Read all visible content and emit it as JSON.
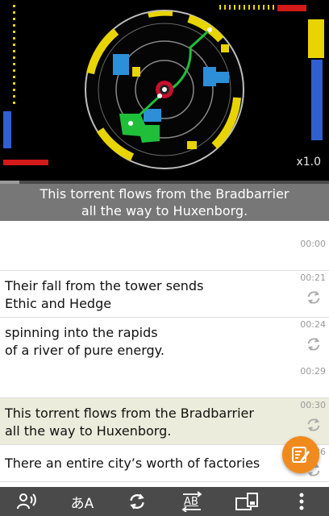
{
  "video": {
    "speed": "x1.0",
    "progress_fraction": 0.06
  },
  "caption": {
    "line1": "This torrent flows from the Bradbarrier",
    "line2": "all the way to Huxenborg."
  },
  "transcript": {
    "rows": [
      {
        "time": "00:00",
        "line1": "",
        "line2": ""
      },
      {
        "time": "00:21",
        "line1": "Their fall from the tower sends",
        "line2": "Ethic and Hedge"
      },
      {
        "time": "00:24",
        "line1": "spinning into the rapids",
        "line2": "of a river of pure energy.",
        "time2": "00:29"
      },
      {
        "time": "00:30",
        "line1": "This torrent flows from the Bradbarrier",
        "line2": "all the way to Huxenborg."
      },
      {
        "time": "00:36",
        "line1": "There an entire city’s worth of factories",
        "line2": ""
      }
    ]
  },
  "colors": {
    "accent": "#f08a1c",
    "active_row": "#ececdc",
    "toolbar": "#4a4a4a",
    "caption_band": "#777777"
  },
  "toolbar": {
    "buttons": [
      "listen-icon",
      "translate-icon",
      "repeat-icon",
      "ab-loop-icon",
      "switch-screen-icon",
      "more-icon"
    ],
    "translate_glyph": "あA",
    "ab_glyph": "AB"
  }
}
